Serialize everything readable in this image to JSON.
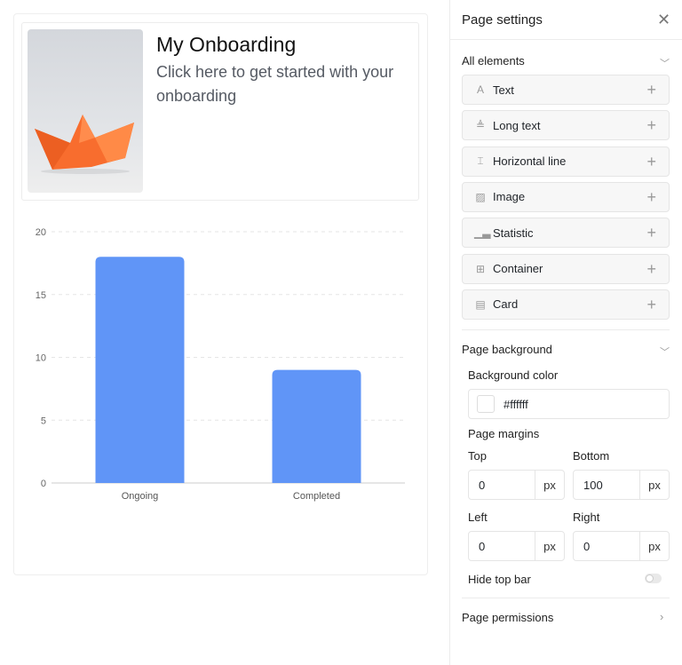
{
  "canvas": {
    "card": {
      "title": "My Onboarding",
      "subtitle": "Click here to get started with your onboarding",
      "image": "orange paper boat"
    },
    "chart_data": {
      "type": "bar",
      "categories": [
        "Ongoing",
        "Completed"
      ],
      "values": [
        18,
        9
      ],
      "ylim": [
        0,
        20
      ],
      "yticks": [
        0,
        5,
        10,
        15,
        20
      ],
      "grid": true,
      "bar_color": "#6095f7"
    }
  },
  "panel": {
    "title": "Page settings",
    "all_elements": {
      "label": "All elements",
      "items": [
        {
          "label": "Text",
          "icon": "text-icon"
        },
        {
          "label": "Long text",
          "icon": "long-text-icon"
        },
        {
          "label": "Horizontal line",
          "icon": "horizontal-line-icon"
        },
        {
          "label": "Image",
          "icon": "image-icon"
        },
        {
          "label": "Statistic",
          "icon": "statistic-icon"
        },
        {
          "label": "Container",
          "icon": "container-icon"
        },
        {
          "label": "Card",
          "icon": "card-icon"
        }
      ]
    },
    "background": {
      "label": "Page background",
      "color_label": "Background color",
      "color_value": "#ffffff",
      "margins_label": "Page margins",
      "top_label": "Top",
      "top": "0",
      "bottom_label": "Bottom",
      "bottom": "100",
      "left_label": "Left",
      "left": "0",
      "right_label": "Right",
      "right": "0",
      "unit": "px",
      "hide_top_bar": "Hide top bar",
      "hide_top_bar_on": false
    },
    "permissions": "Page permissions"
  }
}
